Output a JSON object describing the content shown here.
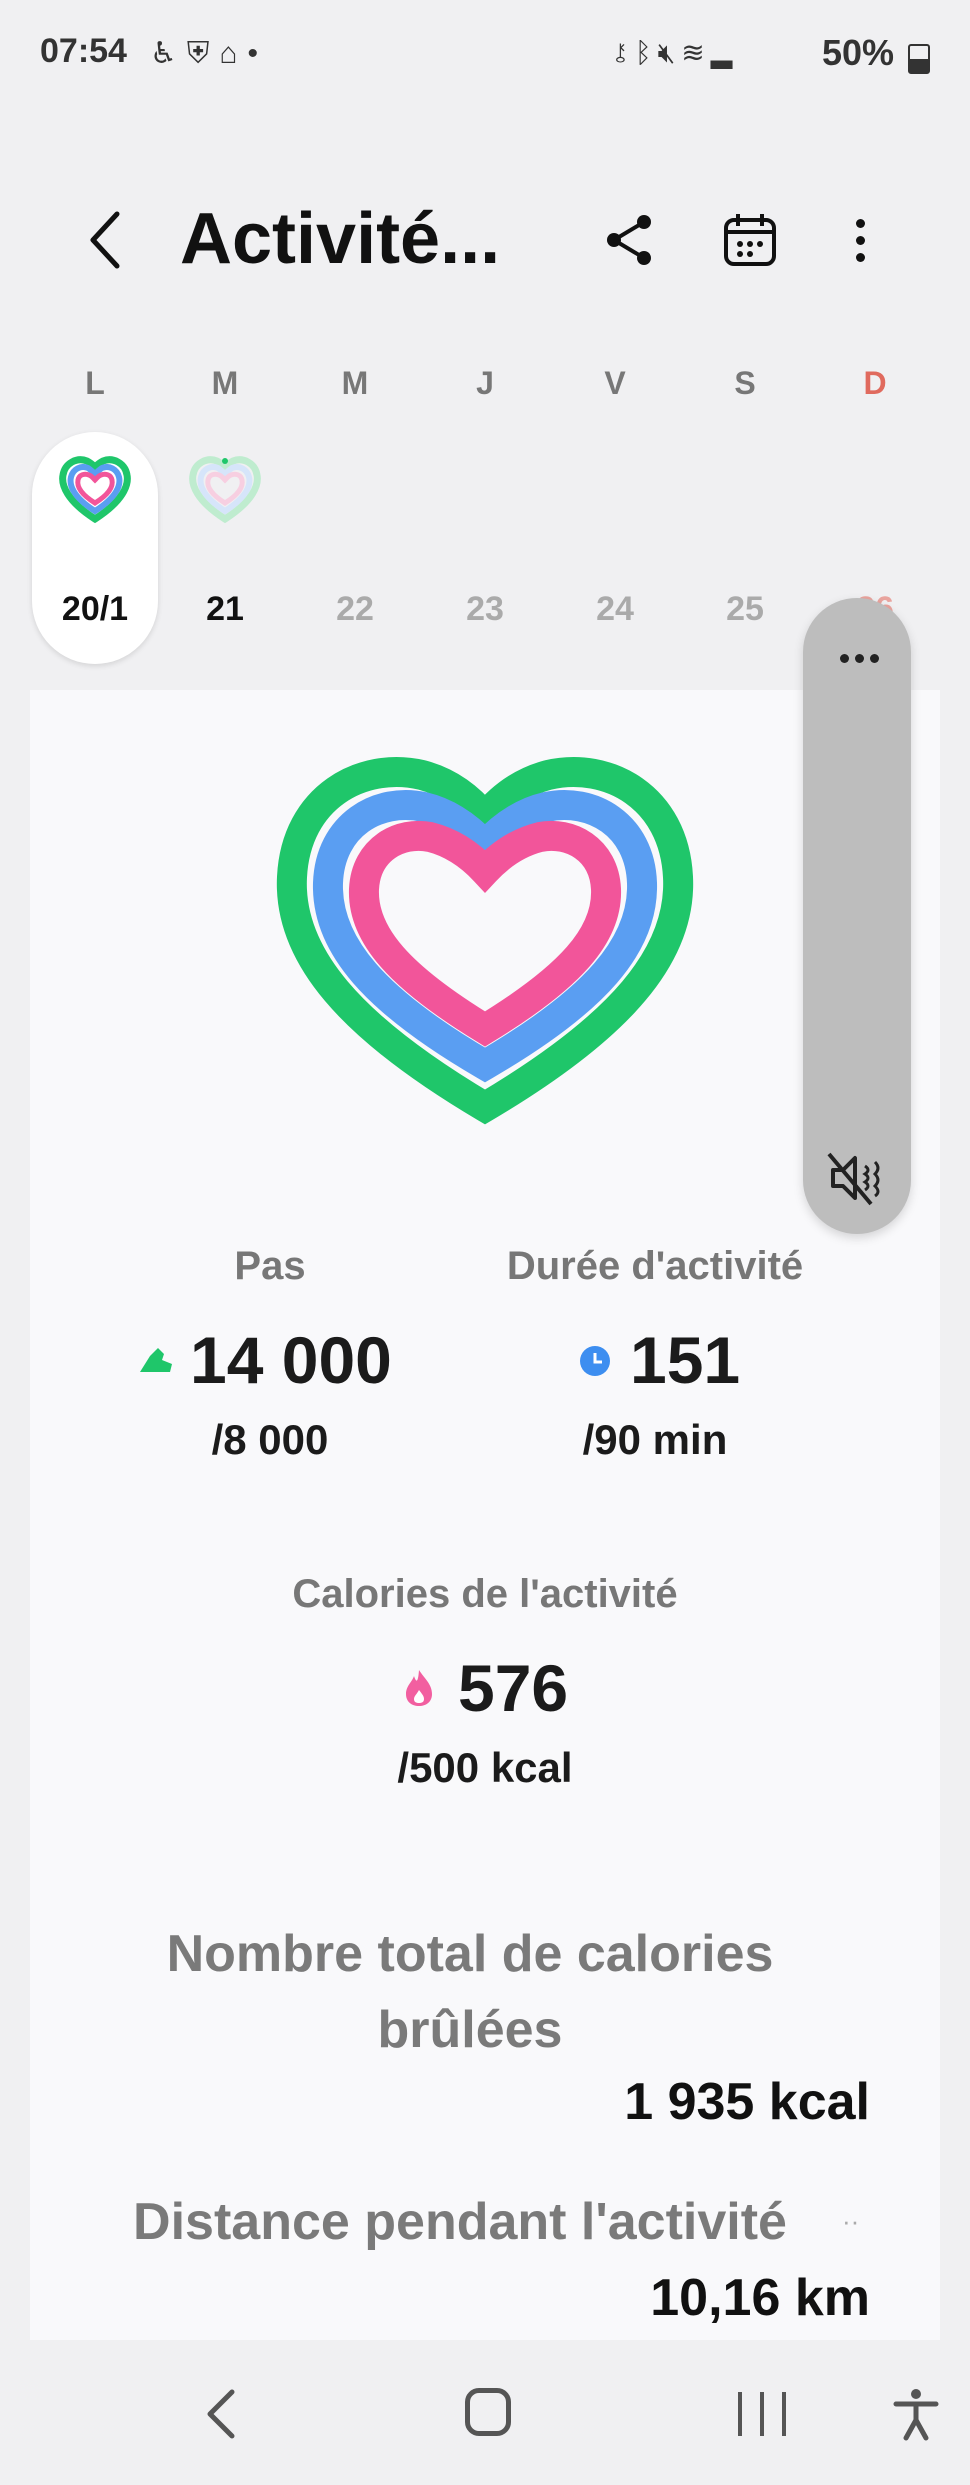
{
  "status_bar": {
    "time": "07:54",
    "battery": "50%",
    "left_icons": [
      "accessibility-icon",
      "shield-icon",
      "broadcast-icon",
      "dot-icon"
    ],
    "right_icons": [
      "key-icon",
      "bluetooth-icon",
      "mute-icon",
      "wifi-icon",
      "signal-icon",
      "battery-icon"
    ]
  },
  "header": {
    "title": "Activité..."
  },
  "week": {
    "day_letters": [
      "L",
      "M",
      "M",
      "J",
      "V",
      "S",
      "D"
    ],
    "dates": [
      "20/1",
      "21",
      "22",
      "23",
      "24",
      "25",
      "26"
    ],
    "selected_index": 0
  },
  "stats": {
    "steps": {
      "label": "Pas",
      "value": "14 000",
      "goal": "/8 000",
      "color": "#1fc66a"
    },
    "active_time": {
      "label": "Durée d'activité",
      "value": "151",
      "goal": "/90 min",
      "color": "#3d8ef0"
    },
    "calories": {
      "label": "Calories de l'activité",
      "value": "576",
      "goal": "/500 kcal",
      "color": "#f25fa0"
    }
  },
  "summary": {
    "total_calories_label": "Nombre total de calories brûlées",
    "total_calories_value": "1 935 kcal",
    "distance_label": "Distance pendant l'activité",
    "distance_value": "10,16 km"
  },
  "colors": {
    "ring_outer": "#1fc66a",
    "ring_middle": "#5a9ef2",
    "ring_inner": "#f2559a",
    "sunday": "#e06a5e"
  }
}
